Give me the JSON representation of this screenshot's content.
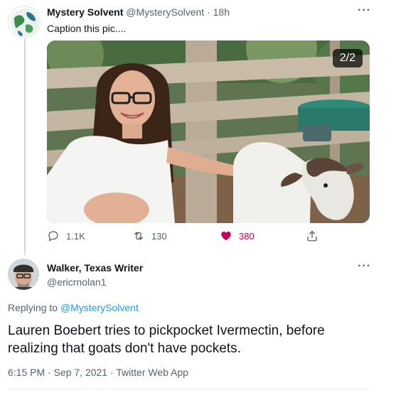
{
  "tweet": {
    "author_name": "Mystery Solvent",
    "author_handle": "@MysterySolvent",
    "separator": "·",
    "time_ago": "18h",
    "text": "Caption this pic....",
    "media_counter": "2/2",
    "replies": "1.1K",
    "retweets": "130",
    "likes": "380",
    "more_icon": "more-horizontal-icon",
    "liked": true,
    "colors": {
      "like": "#c0045a",
      "link": "#1d9bf0",
      "muted": "#536471"
    }
  },
  "reply": {
    "author_name": "Walker, Texas Writer",
    "author_handle": "@ericrnolan1",
    "replying_prefix": "Replying to",
    "replying_to": "@MysterySolvent",
    "text": "Lauren Boebert tries to pickpocket Ivermectin, before realizing that goats don't have pockets.",
    "timestamp": "6:15 PM · Sep 7, 2021 · Twitter Web App"
  }
}
